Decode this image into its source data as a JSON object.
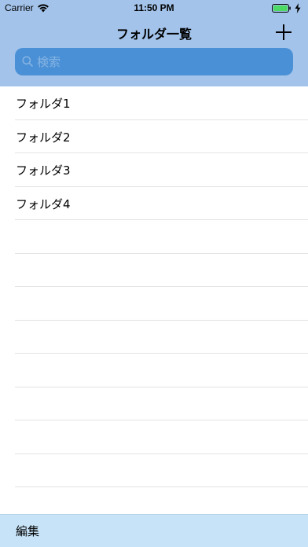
{
  "status_bar": {
    "carrier": "Carrier",
    "time": "11:50 PM"
  },
  "nav": {
    "title": "フォルダ一覧",
    "add_icon": "plus-icon"
  },
  "search": {
    "placeholder": "検索",
    "value": ""
  },
  "folders": [
    {
      "label": "フォルダ1"
    },
    {
      "label": "フォルダ2"
    },
    {
      "label": "フォルダ3"
    },
    {
      "label": "フォルダ4"
    }
  ],
  "toolbar": {
    "edit_label": "編集"
  },
  "colors": {
    "header_bg": "#a3c3ea",
    "search_bg": "#4a90d6",
    "toolbar_bg": "#c7e3f7",
    "separator": "#e3e3e6"
  }
}
